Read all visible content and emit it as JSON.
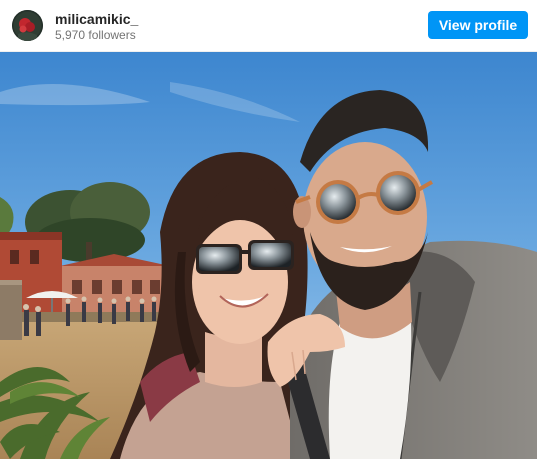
{
  "header": {
    "avatar_icon": "profile-avatar",
    "username": "milicamikic_",
    "followers": "5,970 followers",
    "view_profile_label": "View profile"
  },
  "post": {
    "photo_icon": "post-photo"
  },
  "colors": {
    "button_blue": "#0095f6",
    "username_text": "#262626",
    "secondary_text": "#737373"
  }
}
